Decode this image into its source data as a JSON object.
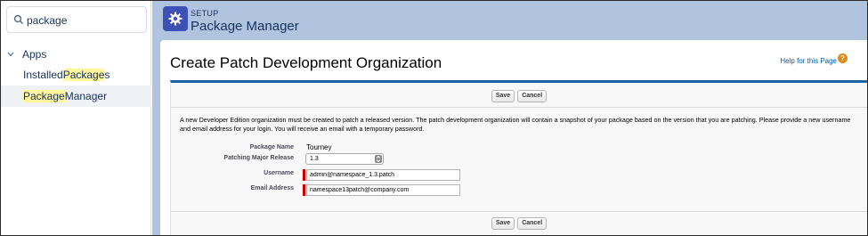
{
  "sidebar": {
    "search": {
      "value": "package",
      "placeholder": ""
    },
    "section_label": "Apps",
    "items": [
      {
        "pre": "Installed ",
        "highlight": "Package",
        "post": "s"
      },
      {
        "pre": "",
        "highlight": "Package",
        "post": " Manager"
      }
    ]
  },
  "header": {
    "category": "SETUP",
    "title": "Package Manager"
  },
  "page": {
    "title": "Create Patch Development Organization",
    "help_link": "Help for this Page",
    "help_icon": "?",
    "buttons": {
      "save": "Save",
      "cancel": "Cancel"
    },
    "notice": "A new Developer Edition organization must be created to patch a released version. The patch development organization will contain a snapshot of your package based on the version that you are patching. Please provide a new username and email address for your login. You will receive an email with a temporary password.",
    "fields": {
      "package_name": {
        "label": "Package Name",
        "value": "Tourney"
      },
      "patching_major_release": {
        "label": "Patching Major Release",
        "value": "1.3"
      },
      "username": {
        "label": "Username",
        "value": "admin@namespace_1.3.patch"
      },
      "email_address": {
        "label": "Email Address",
        "value": "namespace13patch@company.com"
      }
    }
  },
  "colors": {
    "accent": "#1b63a3",
    "app_icon": "#3c51b3",
    "header_bg": "#b0c4df",
    "required": "#cc0000",
    "highlight": "#fff59d",
    "help_icon": "#e08b14"
  }
}
